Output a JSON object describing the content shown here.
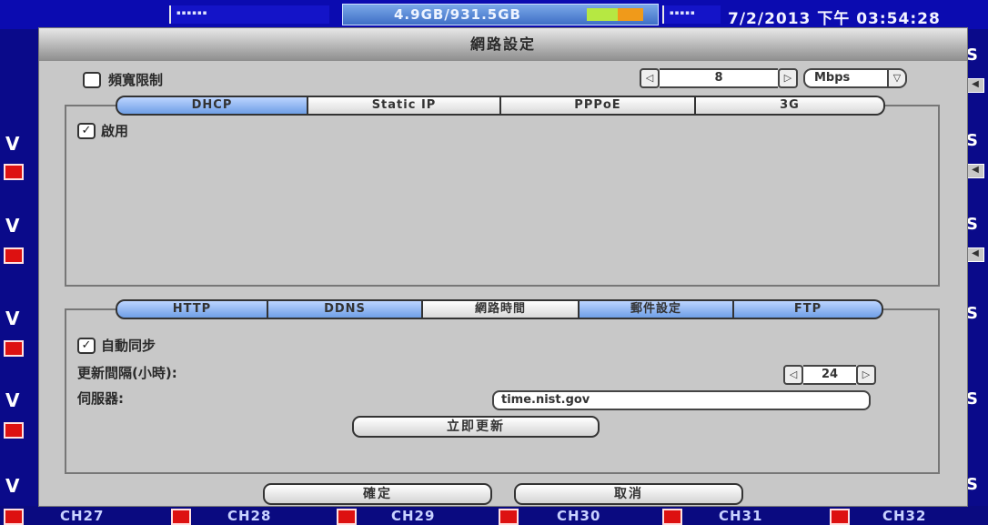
{
  "status": {
    "hdd_usage": "4.9GB/931.5GB",
    "hdd_fill_fraction": 0.55,
    "datetime": "7/2/2013 下午 03:54:28"
  },
  "dialog": {
    "title": "網路設定",
    "bandwidth": {
      "label": "頻寬限制",
      "checked": false,
      "value": "8",
      "unit": "Mbps"
    },
    "connection_tabs": [
      "DHCP",
      "Static IP",
      "PPPoE",
      "3G"
    ],
    "connection_active": 0,
    "enable": {
      "label": "啟用",
      "checked": true
    },
    "service_tabs": [
      "HTTP",
      "DDNS",
      "網路時間",
      "郵件設定",
      "FTP"
    ],
    "service_active": 2,
    "ntp": {
      "auto_sync_label": "自動同步",
      "auto_sync_checked": true,
      "interval_label": "更新間隔(小時):",
      "interval_value": "24",
      "server_label": "伺服器:",
      "server_value": "time.nist.gov",
      "update_now": "立即更新"
    },
    "ok": "確定",
    "cancel": "取消"
  },
  "channels": [
    "CH27",
    "CH28",
    "CH29",
    "CH30",
    "CH31",
    "CH32"
  ],
  "colors": {
    "background": "#0a0a8a",
    "dialog": "#c8c8c8",
    "tab_blue": "#6f9fe6",
    "rec_red": "#dd1111"
  },
  "icons": {
    "checked": "✓",
    "left": "◁",
    "right": "▷",
    "down": "▽"
  }
}
